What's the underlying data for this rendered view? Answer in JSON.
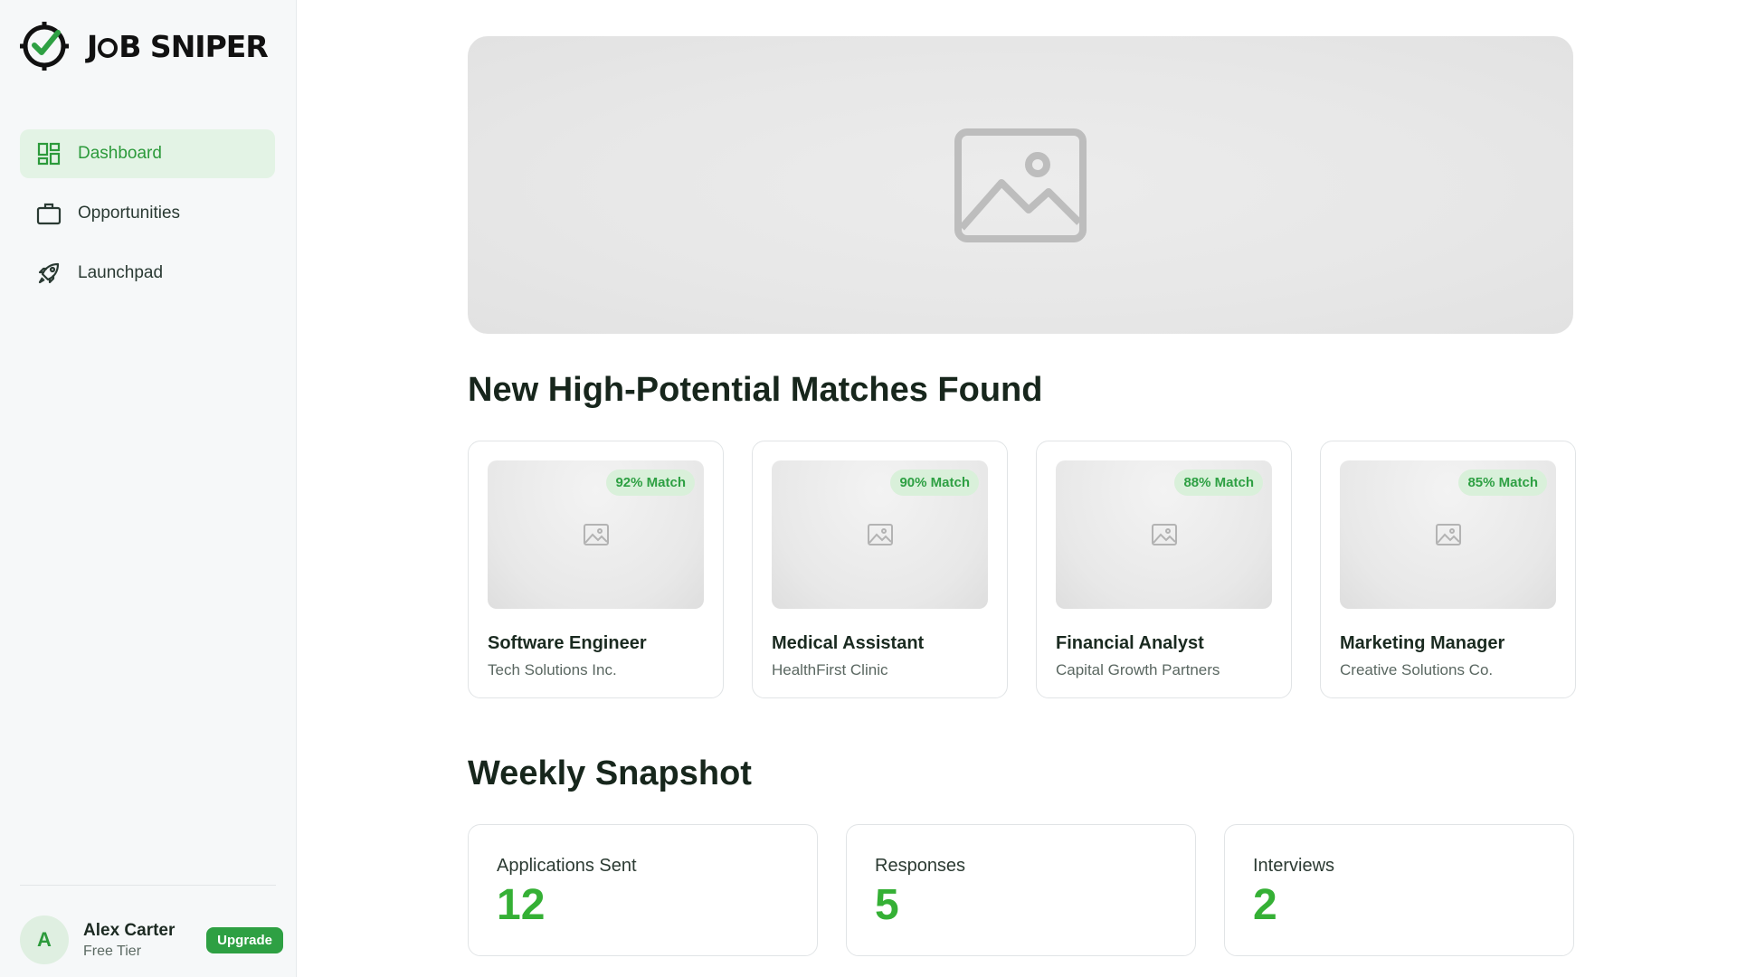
{
  "app": {
    "logo_text_a": "J",
    "logo_text_b": "B SNIPER",
    "brand_color": "#2ea043"
  },
  "sidebar": {
    "items": [
      {
        "label": "Dashboard",
        "icon": "dashboard-icon",
        "active": true
      },
      {
        "label": "Opportunities",
        "icon": "briefcase-icon",
        "active": false
      },
      {
        "label": "Launchpad",
        "icon": "rocket-icon",
        "active": false
      }
    ]
  },
  "user": {
    "initial": "A",
    "name": "Alex Carter",
    "tier": "Free Tier",
    "upgrade_label": "Upgrade"
  },
  "main": {
    "hero_icon": "image-placeholder-icon",
    "matches_title": "New High-Potential Matches Found",
    "matches": [
      {
        "badge": "92% Match",
        "title": "Software Engineer",
        "company": "Tech Solutions Inc."
      },
      {
        "badge": "90% Match",
        "title": "Medical Assistant",
        "company": "HealthFirst Clinic"
      },
      {
        "badge": "88% Match",
        "title": "Financial Analyst",
        "company": "Capital Growth Partners"
      },
      {
        "badge": "85% Match",
        "title": "Marketing Manager",
        "company": "Creative Solutions Co."
      }
    ],
    "snapshot_title": "Weekly Snapshot",
    "stats": [
      {
        "label": "Applications Sent",
        "value": "12"
      },
      {
        "label": "Responses",
        "value": "5"
      },
      {
        "label": "Interviews",
        "value": "2"
      }
    ]
  }
}
